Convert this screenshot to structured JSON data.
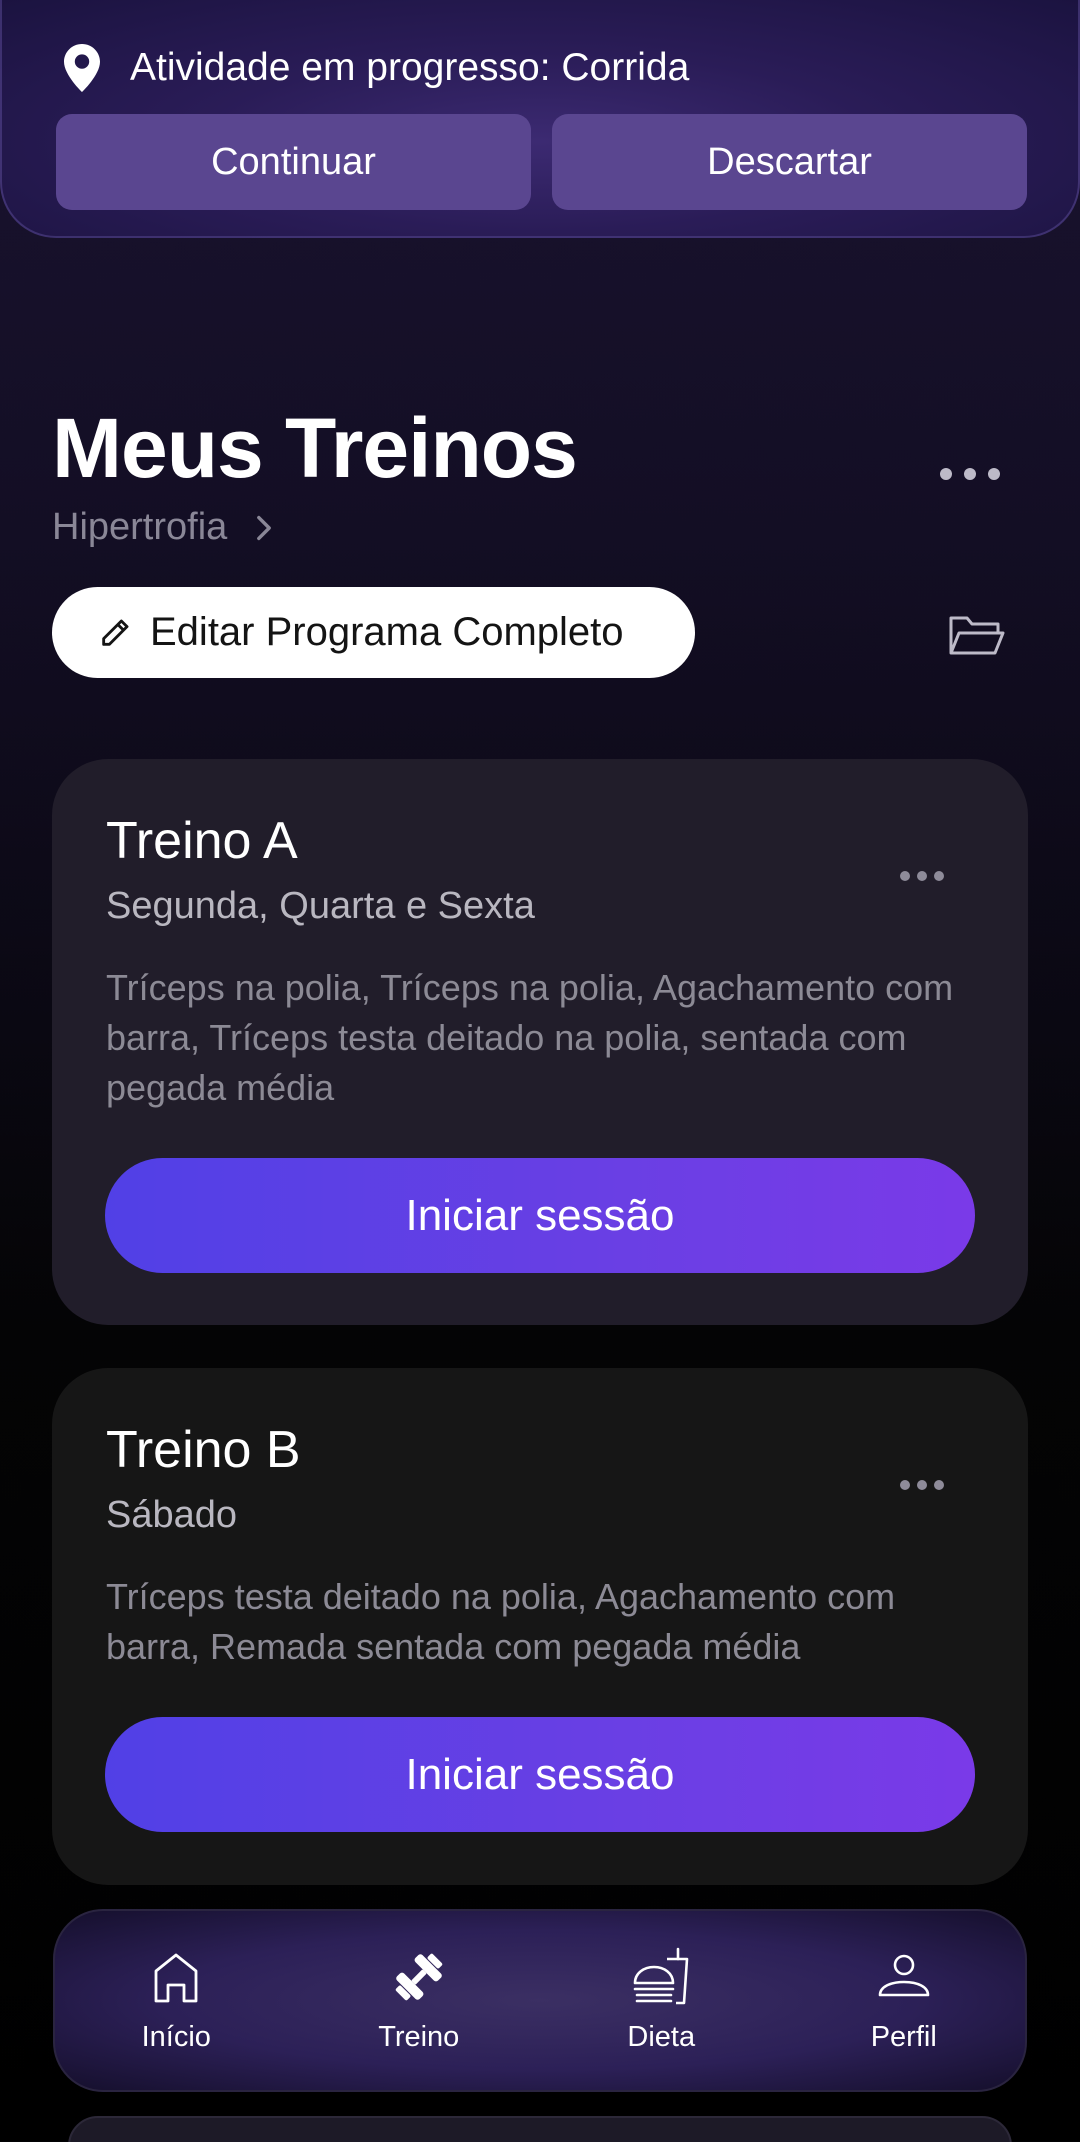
{
  "activity_banner": {
    "text": "Atividade em progresso: Corrida",
    "continue_label": "Continuar",
    "discard_label": "Descartar"
  },
  "header": {
    "title": "Meus Treinos",
    "program_name": "Hipertrofia",
    "edit_label": "Editar Programa Completo"
  },
  "workouts": [
    {
      "title": "Treino A",
      "days": "Segunda, Quarta e Sexta",
      "exercises": "Tríceps na polia, Tríceps na polia, Agachamento com barra, Tríceps testa deitado na polia, sentada com pegada média",
      "start_label": "Iniciar sessão"
    },
    {
      "title": "Treino B",
      "days": "Sábado",
      "exercises": "Tríceps testa deitado na polia, Agachamento com barra, Remada sentada com pegada média",
      "start_label": "Iniciar sessão"
    }
  ],
  "bottom_nav": {
    "items": [
      {
        "label": "Início",
        "icon": "home-icon",
        "active": false
      },
      {
        "label": "Treino",
        "icon": "dumbbell-icon",
        "active": true
      },
      {
        "label": "Dieta",
        "icon": "food-icon",
        "active": false
      },
      {
        "label": "Perfil",
        "icon": "user-icon",
        "active": false
      }
    ]
  },
  "colors": {
    "accent": "#7a3ae8",
    "accent_start": "#5140e6",
    "banner_button": "#5a4690",
    "card_a": "#211d2a",
    "card_b": "#161616"
  }
}
